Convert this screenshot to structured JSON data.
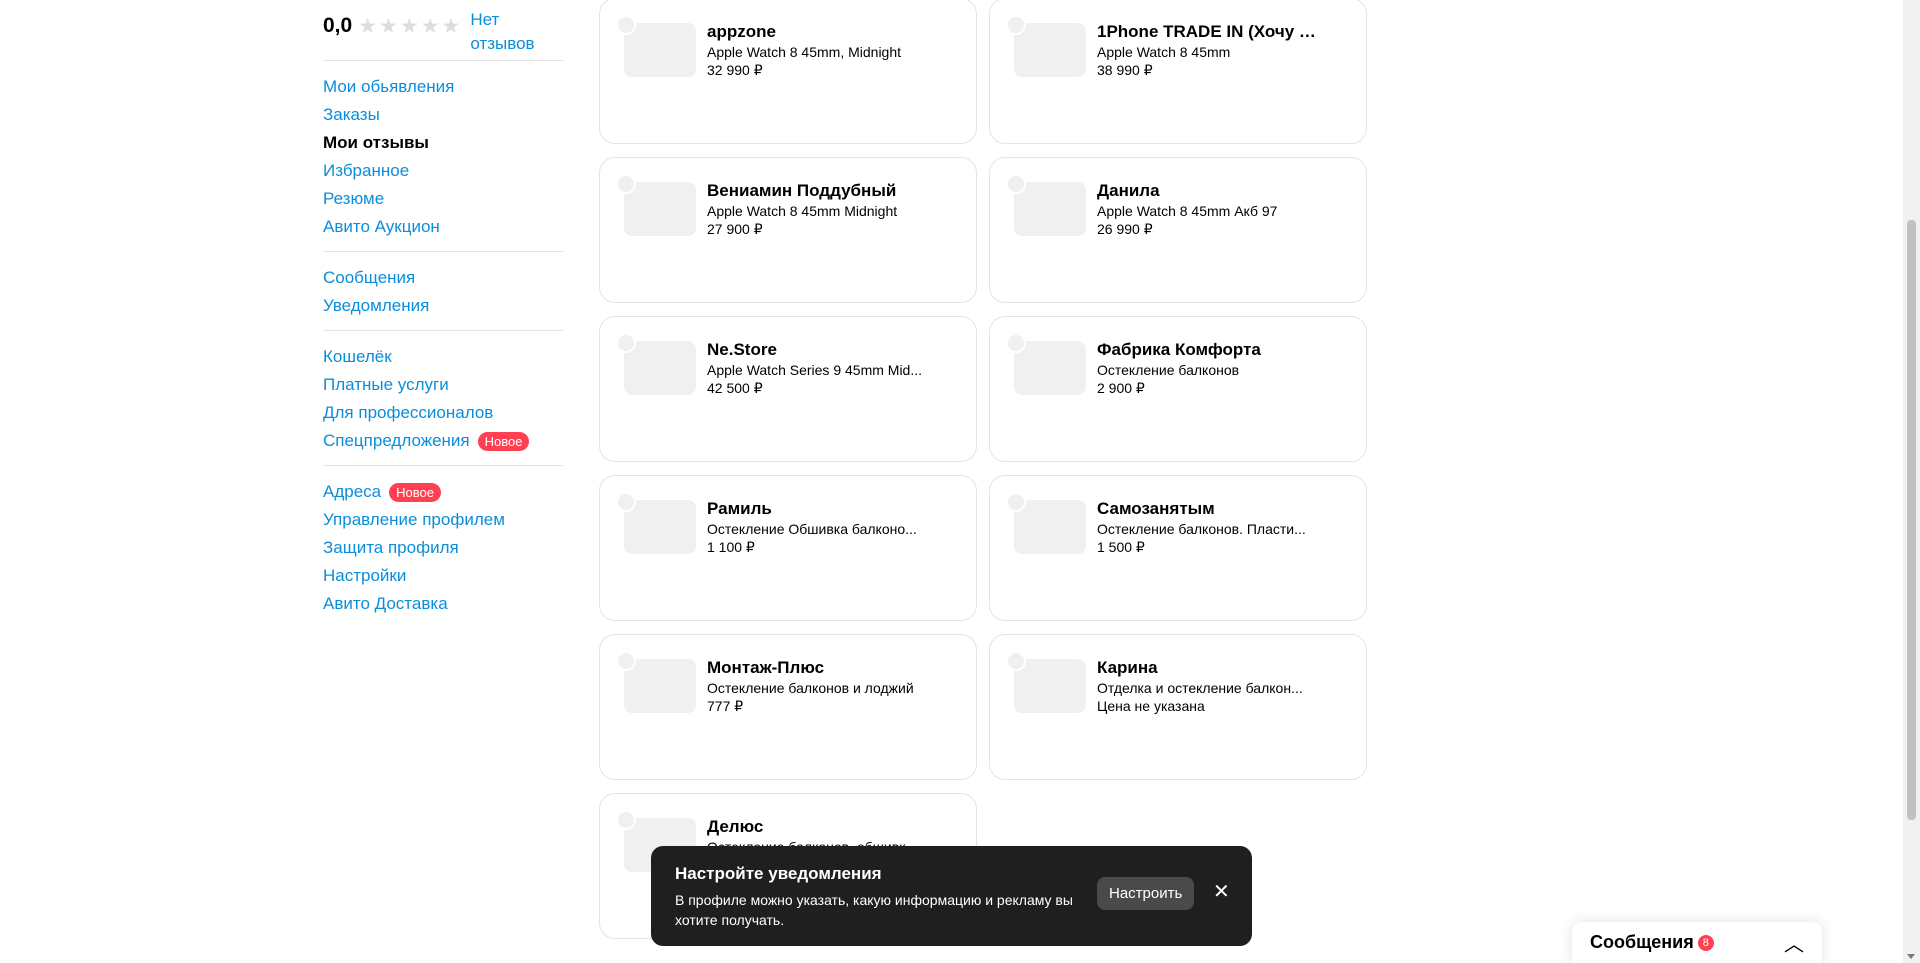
{
  "rating": {
    "value": "0,0",
    "no_reviews": "Нет отзывов"
  },
  "sidebar": {
    "group1": [
      {
        "label": "Мои обьявления",
        "active": false
      },
      {
        "label": "Заказы",
        "active": false
      },
      {
        "label": "Мои отзывы",
        "active": true
      },
      {
        "label": "Избранное",
        "active": false
      },
      {
        "label": "Резюме",
        "active": false
      },
      {
        "label": "Авито Аукцион",
        "active": false
      }
    ],
    "group2": [
      {
        "label": "Сообщения"
      },
      {
        "label": "Уведомления"
      }
    ],
    "group3": [
      {
        "label": "Кошелёк"
      },
      {
        "label": "Платные услуги"
      },
      {
        "label": "Для профессионалов"
      },
      {
        "label": "Спецпредложения",
        "badge": "Новое"
      }
    ],
    "group4": [
      {
        "label": "Адреса",
        "badge": "Новое"
      },
      {
        "label": "Управление профилем"
      },
      {
        "label": "Защита профиля"
      },
      {
        "label": "Настройки"
      },
      {
        "label": "Авито Доставка"
      }
    ]
  },
  "cards": [
    {
      "seller": "appzone",
      "item": "Apple Watch 8 45mm, Midnight",
      "price": "32 990 ₽"
    },
    {
      "seller": "1Phone TRADE IN (Хочу Но...",
      "item": "Apple Watch 8 45mm",
      "price": "38 990 ₽"
    },
    {
      "seller": "Вениамин Поддубный",
      "item": "Apple Watch 8 45mm Midnight",
      "price": "27 900 ₽"
    },
    {
      "seller": "Данила",
      "item": "Apple Watch 8 45mm Акб 97",
      "price": "26 990 ₽"
    },
    {
      "seller": "Ne.Store",
      "item": "Apple Watch Series 9 45mm Mid...",
      "price": "42 500 ₽"
    },
    {
      "seller": "Фабрика Комфорта",
      "item": "Остекление балконов",
      "price": "2 900 ₽"
    },
    {
      "seller": "Рамиль",
      "item": "Остекление Обшивка балконо...",
      "price": "1 100 ₽"
    },
    {
      "seller": "Самозанятым",
      "item": "Остекление балконов. Пласти...",
      "price": "1 500 ₽"
    },
    {
      "seller": "Монтаж-Плюс",
      "item": "Остекление балконов и лоджий",
      "price": "777 ₽"
    },
    {
      "seller": "Карина",
      "item": "Отделка и остекление балкон...",
      "price": "Цена не указана"
    },
    {
      "seller": "Делюс",
      "item": "Остекление балконов, обшивк",
      "price": ""
    }
  ],
  "toast": {
    "title": "Настройте уведомления",
    "text": "В профиле можно указать, какую информацию и рекламу вы хотите получать.",
    "button": "Настроить",
    "close_icon": "✕"
  },
  "messages": {
    "label": "Сообщения",
    "count": "8",
    "chevron": "︿"
  },
  "colors": {
    "link": "#0a8edb",
    "badge": "#ff4053",
    "toast_bg": "#1f1f1f"
  }
}
